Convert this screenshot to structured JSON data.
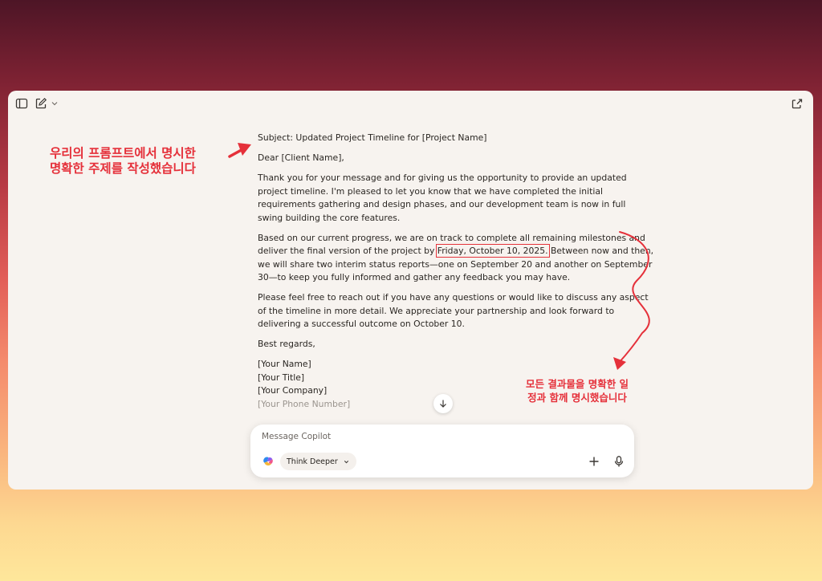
{
  "toolbar": {
    "sidebar_icon": "sidebar-toggle-icon",
    "new_chat_icon": "compose-icon",
    "menu_icon": "chevron-down-icon",
    "share_icon": "share-icon"
  },
  "email": {
    "subject": "Subject: Updated Project Timeline for [Project Name]",
    "greeting": "Dear [Client Name],",
    "para1_lines": [
      "Thank you for your message and for giving us the opportunity to provide an updated",
      "project timeline. I'm pleased to let you know that we have completed the initial",
      "requirements gathering and design phases, and our development team is now in full",
      "swing building the core features."
    ],
    "para2": {
      "line1": "Based on our current progress, we are on track to complete all remaining milestones and",
      "line2_before": "deliver the final version of the project by ",
      "line2_highlight": "Friday, October 10, 2025.",
      "line2_after": " Between now and then,",
      "line3": "we will share two interim status reports—one on September 20 and another on September",
      "line4": "30—to keep you fully informed and gather any feedback you may have."
    },
    "para3_lines": [
      "Please feel free to reach out if you have any questions or would like to discuss any aspect",
      "of the timeline in more detail. We appreciate your partnership and look forward to",
      "delivering a successful outcome on October 10."
    ],
    "closing": "Best regards,",
    "signature_lines": [
      "[Your Name]",
      "[Your Title]",
      "[Your Company]"
    ],
    "signature_faded": "[Your Phone Number]"
  },
  "composer": {
    "placeholder": "Message Copilot",
    "mode_label": "Think Deeper"
  },
  "annotations": {
    "left_lines": [
      "우리의 프롬프트에서 명시한",
      "명확한 주제를 작성했습니다"
    ],
    "right_lines": [
      "모든 결과물을 명확한 일",
      "정과 함께 명시했습니다"
    ]
  },
  "colors": {
    "annotation_red": "#e5303a",
    "window_bg": "#f7f3ef",
    "text": "#2a2622"
  }
}
